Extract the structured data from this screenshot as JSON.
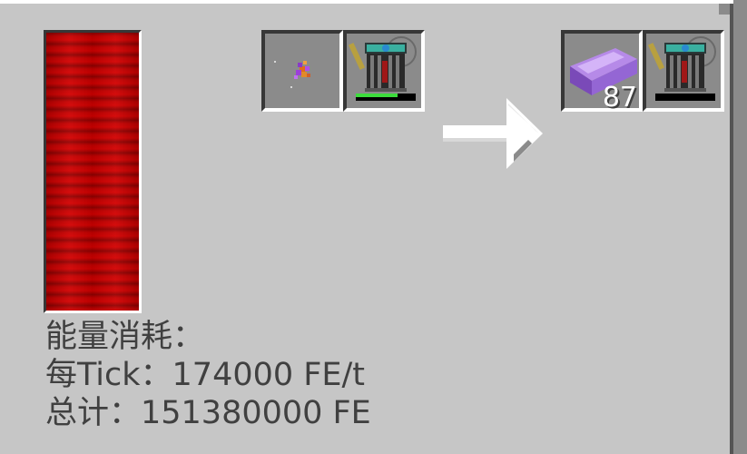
{
  "machine": {
    "energy_bar": {
      "fill_fraction": 1.0,
      "color": "#c80000"
    },
    "input_slots": [
      {
        "item_icon": "purple-orange-ore-cluster-icon"
      },
      {
        "item_icon": "machine-upgrade-icon",
        "progress_fraction": 0.7,
        "progress_color": "#3cdc3c"
      }
    ],
    "progress_arrow": {
      "icon": "right-arrow-icon",
      "progress_fraction": 0
    },
    "output_slots": [
      {
        "item_icon": "purple-ingot-icon",
        "count": "87"
      },
      {
        "item_icon": "machine-upgrade-icon",
        "progress_fraction": 0
      }
    ]
  },
  "energy_info": {
    "heading": "能量消耗：",
    "per_tick": "每Tick：174000 FE/t",
    "total": "总计：151380000 FE"
  }
}
